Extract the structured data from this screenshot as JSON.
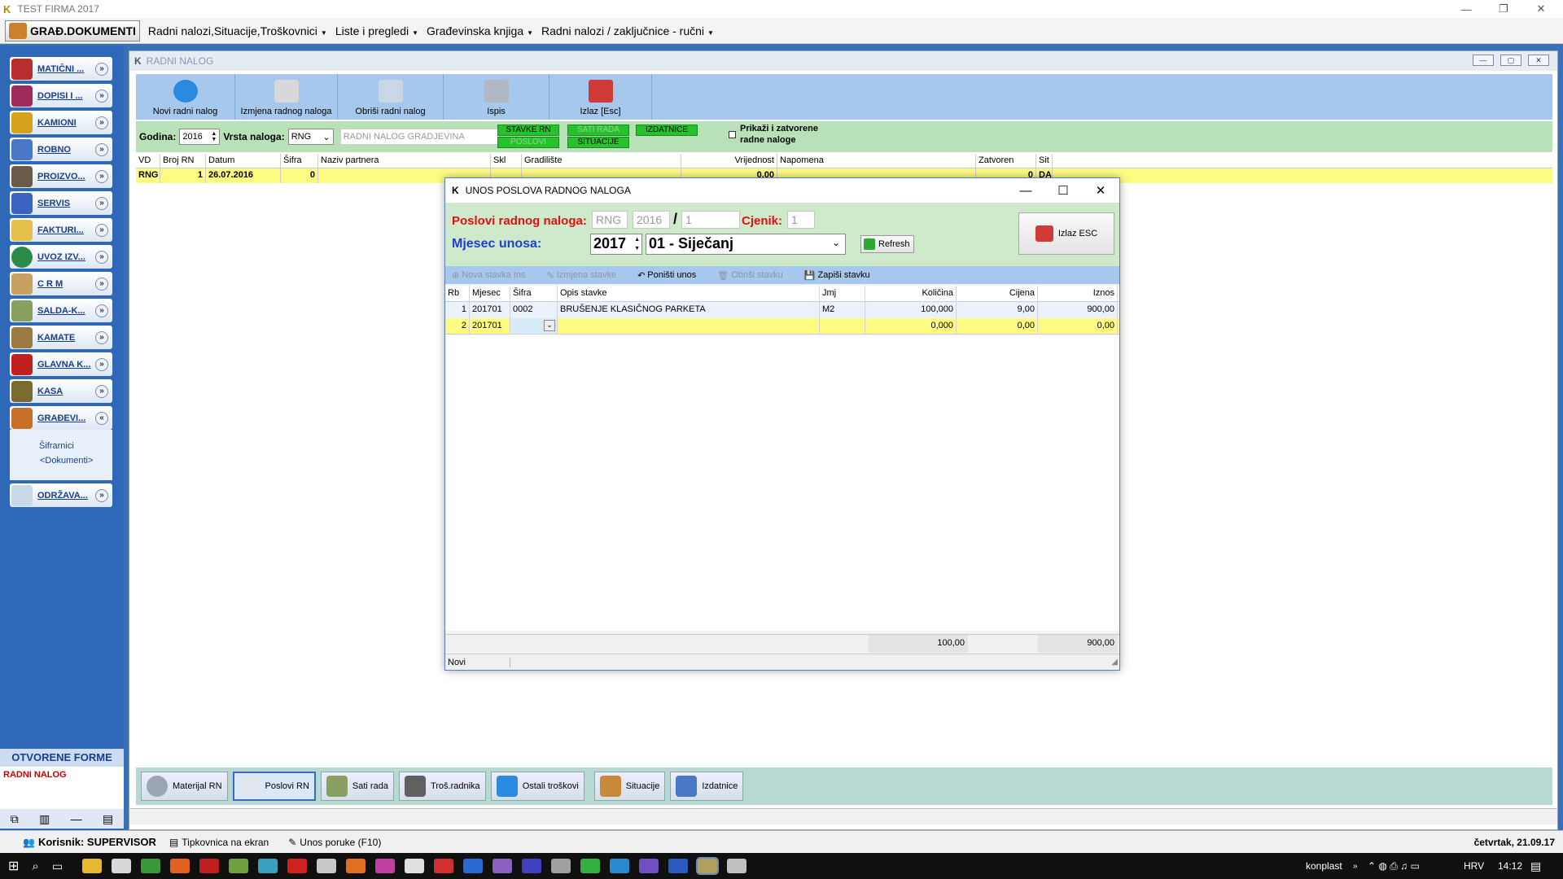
{
  "window": {
    "title": "TEST FIRMA   2017"
  },
  "menu": {
    "main_button": "GRAĐ.DOKUMENTI",
    "items": [
      "Radni nalozi,Situacije,Troškovnici",
      "Liste i pregledi",
      "Građevinska knjiga",
      "Radni nalozi / zaključnice - ručni"
    ]
  },
  "sidebar": {
    "items": [
      "MATIČNI ...",
      "DOPISI I ...",
      "KAMIONI",
      "ROBNO",
      "PROIZVO...",
      "SERVIS",
      "FAKTURI...",
      "UVOZ IZV...",
      "C R M",
      "SALDA-K...",
      "KAMATE",
      "GLAVNA K...",
      "KASA",
      "GRAĐEVI...",
      "ODRŽAVA..."
    ],
    "sub_items": [
      "Šifrarnici",
      "<Dokumenti>"
    ],
    "open_forms_title": "OTVORENE FORME",
    "open_forms": [
      "RADNI NALOG"
    ]
  },
  "child": {
    "title": "RADNI NALOG",
    "toolbar": [
      "Novi radni nalog",
      "Izmjena radnog naloga",
      "Obriši radni nalog",
      "Ispis",
      "Izlaz [Esc]"
    ],
    "filter": {
      "godina_label": "Godina:",
      "godina": "2016",
      "vrsta_label": "Vrsta naloga:",
      "vrsta": "RNG",
      "vrsta_placeholder": "RADNI NALOG GRADJEVINA",
      "btn_stavke": "STAVKE RN",
      "btn_poslovi": "POSLOVI",
      "btn_sati": "SATI RADA",
      "btn_situacije": "SITUACIJE",
      "btn_izdatnice": "IZDATNICE",
      "chk_line1": "Prikaži i zatvorene",
      "chk_line2": "radne naloge"
    },
    "grid": {
      "columns": [
        "VD",
        "Broj RN",
        "Datum",
        "Šifra",
        "Naziv partnera",
        "Skl",
        "Gradilište",
        "Vrijednost",
        "Napomena",
        "Zatvoren",
        "Sit"
      ],
      "row": [
        "RNG",
        "1",
        "26.07.2016",
        "0",
        "",
        "",
        "",
        "0,00",
        "",
        "0",
        "DA"
      ]
    },
    "tabs": [
      "Materijal RN",
      "Poslovi RN",
      "Sati rada",
      "Troš.radnika",
      "Ostali troškovi",
      "Situacije",
      "Izdatnice"
    ]
  },
  "dialog": {
    "title": "UNOS POSLOVA RADNOG  NALOGA",
    "poslovi_label": "Poslovi radnog naloga:",
    "vd": "RNG",
    "godina": "2016",
    "slash": "/",
    "broj": "1",
    "cjenik_label": "Cjenik:",
    "cjenik": "1",
    "mjesec_label": "Mjesec unosa:",
    "mjesec_godina": "2017",
    "mjesec": "01 - Siječanj",
    "refresh": "Refresh",
    "izlaz": "Izlaz ESC",
    "toolbar": [
      "Nova stavka Ins",
      "Izmjena stavke",
      "Poništi unos",
      "Obriši stavku",
      "Zapiši stavku"
    ],
    "columns": [
      "Rb",
      "Mjesec",
      "Šifra",
      "Opis stavke",
      "Jmj",
      "Količina",
      "Cijena",
      "Iznos"
    ],
    "rows": [
      [
        "1",
        "201701",
        "0002",
        "BRUŠENJE KLASIČNOG PARKETA",
        "M2",
        "100,000",
        "9,00",
        "900,00"
      ],
      [
        "2",
        "201701",
        "",
        "",
        "",
        "0,000",
        "0,00",
        "0,00"
      ]
    ],
    "sum_kolicina": "100,00",
    "sum_iznos": "900,00",
    "status": "Novi"
  },
  "status": {
    "user": "Korisnik: SUPERVISOR",
    "keyboard": "Tipkovnica na ekran",
    "message": "Unos poruke (F10)",
    "date": "četvrtak, 21.09.17"
  },
  "taskbar": {
    "user": "konplast",
    "lang": "HRV",
    "time": "14:12"
  }
}
